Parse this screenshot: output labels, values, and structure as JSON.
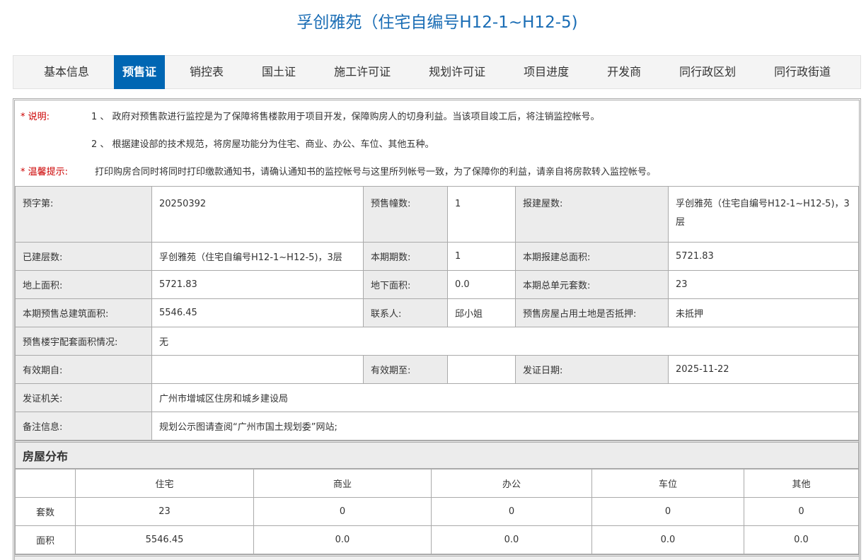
{
  "title": "孚创雅苑（住宅自编号H12-1~H12-5)",
  "tabs": [
    "基本信息",
    "预售证",
    "销控表",
    "国土证",
    "施工许可证",
    "规划许可证",
    "项目进度",
    "开发商",
    "同行政区划",
    "同行政街道"
  ],
  "active_tab": 1,
  "notes": {
    "explain_label": "* 说明:",
    "explain_1": "1 、 政府对预售款进行监控是为了保障将售楼款用于项目开发，保障购房人的切身利益。当该项目竣工后，将注销监控帐号。",
    "explain_2": "2 、 根据建设部的技术规范，将房屋功能分为住宅、商业、办公、车位、其他五种。",
    "tip_label": "* 温馨提示:",
    "tip": "打印购房合同时将同时打印缴款通知书，请确认通知书的监控帐号与这里所列帐号一致，为了保障你的利益，请亲自将房款转入监控帐号。"
  },
  "info": [
    [
      [
        "预字第:",
        "20250392"
      ],
      [
        "预售幢数:",
        "1"
      ],
      [
        "报建屋数:",
        "孚创雅苑（住宅自编号H12-1~H12-5)，3层"
      ]
    ],
    [
      [
        "已建层数:",
        "孚创雅苑（住宅自编号H12-1~H12-5)，3层"
      ],
      [
        "本期期数:",
        "1"
      ],
      [
        "本期报建总面积:",
        "5721.83"
      ]
    ],
    [
      [
        "地上面积:",
        "5721.83"
      ],
      [
        "地下面积:",
        "0.0"
      ],
      [
        "本期总单元套数:",
        "23"
      ]
    ],
    [
      [
        "本期预售总建筑面积:",
        "5546.45"
      ],
      [
        "联系人:",
        "邱小姐"
      ],
      [
        "预售房屋占用土地是否抵押:",
        "未抵押"
      ]
    ],
    [
      [
        "预售楼宇配套面积情况:",
        "无"
      ]
    ],
    [
      [
        "有效期自:",
        ""
      ],
      [
        "有效期至:",
        ""
      ],
      [
        "发证日期:",
        "2025-11-22"
      ]
    ],
    [
      [
        "发证机关:",
        "广州市增城区住房和城乡建设局"
      ]
    ],
    [
      [
        "备注信息:",
        "规划公示图请查阅“广州市国土规划委”网站;"
      ]
    ]
  ],
  "distribution": {
    "title": "房屋分布",
    "headers": [
      "",
      "住宅",
      "商业",
      "办公",
      "车位",
      "其他"
    ],
    "rows": [
      [
        "套数",
        "23",
        "0",
        "0",
        "0",
        "0"
      ],
      [
        "面积",
        "5546.45",
        "0.0",
        "0.0",
        "0.0",
        "0.0"
      ]
    ]
  }
}
